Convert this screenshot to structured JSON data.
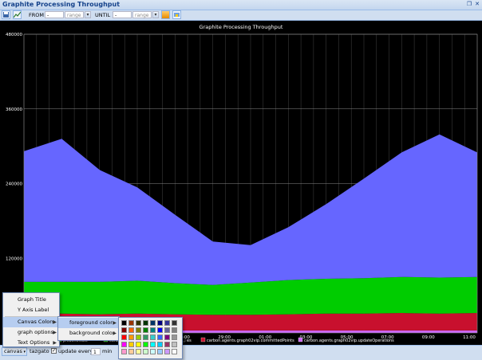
{
  "window": {
    "title": "Graphite Processing Throughput"
  },
  "toolbar": {
    "from_label": "FROM",
    "from_value": "-",
    "from_range_placeholder": "range",
    "until_label": "UNTIL",
    "until_value": "-",
    "until_range_placeholder": "range"
  },
  "chart_data": {
    "type": "area",
    "title": "Graphite Processing Throughput",
    "xlabel": "",
    "ylabel": "",
    "ylim": [
      0,
      480000
    ],
    "yticks": [
      "120000",
      "240000",
      "360000",
      "480000"
    ],
    "xticks": [
      "01:00",
      "29:00",
      "01:00",
      "03:00",
      "05:00",
      "07:00",
      "09:00",
      "11:00"
    ],
    "grid": true,
    "background": "#000000",
    "series": [
      {
        "name": "carbon.agents.graph02vip.updateOperations",
        "color": "#cc66ff",
        "values": [
          4000,
          4000,
          4000,
          4000,
          4000,
          4000,
          4000,
          4000,
          4000,
          4000,
          4000,
          4000,
          4000
        ]
      },
      {
        "name": "carbon.agents.graph02vip.committedPoints",
        "color": "#c8102e",
        "values": [
          28000,
          27000,
          26000,
          27000,
          26000,
          25000,
          25000,
          26000,
          27000,
          27000,
          28000,
          27000,
          28000
        ]
      },
      {
        "name": "carbon.agents.graph02vip.cache.size",
        "color": "#00cc00",
        "values": [
          50000,
          51000,
          52000,
          53000,
          50000,
          48000,
          52000,
          55000,
          56000,
          57000,
          58000,
          58000,
          58000
        ]
      },
      {
        "name": "",
        "color": "#6666ff",
        "values": [
          210000,
          230000,
          180000,
          150000,
          110000,
          70000,
          60000,
          85000,
          120000,
          160000,
          200000,
          230000,
          200000
        ]
      }
    ],
    "legend_visible": [
      {
        "label": "p.cache.size",
        "color": "#00cc00"
      },
      {
        "label": "carb",
        "color": "#00cc00"
      },
      {
        "label": "es",
        "color": "#000000"
      },
      {
        "label": "carbon.agents.graph02vip.committedPoints",
        "color": "#c8102e"
      },
      {
        "label": "carbon.agents.graph02vip.updateOperations",
        "color": "#cc66ff"
      }
    ]
  },
  "context_menu": {
    "items": [
      {
        "label": "Graph Title",
        "has_submenu": false
      },
      {
        "label": "Y Axis Label",
        "has_submenu": false
      },
      {
        "label": "Canvas Colors",
        "has_submenu": true
      },
      {
        "label": "graph options",
        "has_submenu": true
      },
      {
        "label": "Text Options",
        "has_submenu": true
      }
    ]
  },
  "sub_menu": {
    "items": [
      {
        "label": "foreground color",
        "has_submenu": true
      },
      {
        "label": "background color",
        "has_submenu": true
      }
    ]
  },
  "palette": [
    [
      "#000000",
      "#993300",
      "#333300",
      "#003300",
      "#003366",
      "#000080",
      "#333399",
      "#333333"
    ],
    [
      "#800000",
      "#ff6600",
      "#808000",
      "#008000",
      "#008080",
      "#0000ff",
      "#666699",
      "#808080"
    ],
    [
      "#ff0000",
      "#ff9900",
      "#99cc00",
      "#339966",
      "#33cccc",
      "#3366ff",
      "#800080",
      "#969696"
    ],
    [
      "#ff00ff",
      "#ffcc00",
      "#ffff00",
      "#00ff00",
      "#00ffff",
      "#00ccff",
      "#993366",
      "#c0c0c0"
    ],
    [
      "#ff99cc",
      "#ffcc99",
      "#ffff99",
      "#ccffcc",
      "#ccffff",
      "#99ccff",
      "#cc99ff",
      "#ffffff"
    ]
  ],
  "bottom": {
    "canvas_button": "canvas",
    "user": "tazgato",
    "update_label": "update every",
    "update_value": "1",
    "unit": "min"
  }
}
